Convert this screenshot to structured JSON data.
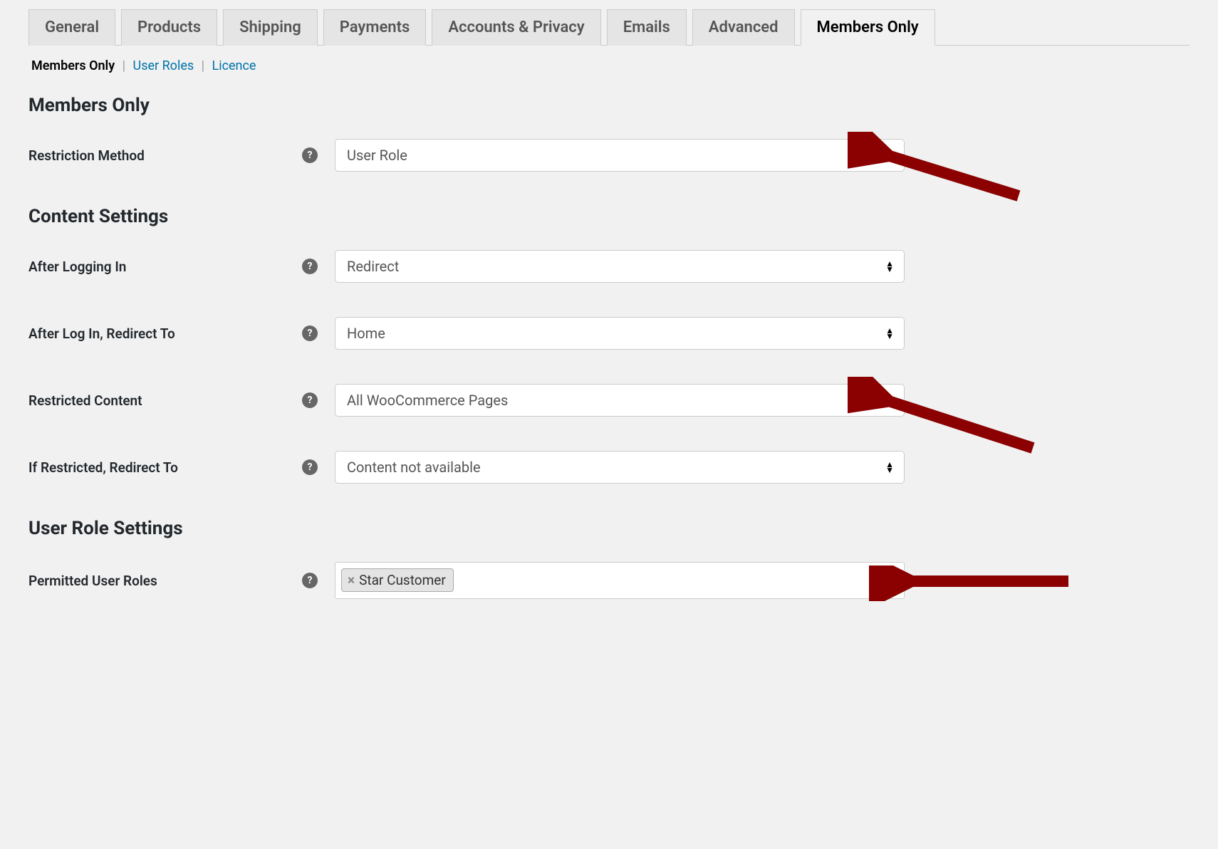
{
  "tabs": [
    {
      "label": "General"
    },
    {
      "label": "Products"
    },
    {
      "label": "Shipping"
    },
    {
      "label": "Payments"
    },
    {
      "label": "Accounts & Privacy"
    },
    {
      "label": "Emails"
    },
    {
      "label": "Advanced"
    },
    {
      "label": "Members Only",
      "active": true
    }
  ],
  "subnav": {
    "items": [
      {
        "label": "Members Only",
        "current": true
      },
      {
        "label": "User Roles"
      },
      {
        "label": "Licence"
      }
    ]
  },
  "sections": {
    "members_only": {
      "title": "Members Only",
      "restriction_method": {
        "label": "Restriction Method",
        "value": "User Role"
      }
    },
    "content_settings": {
      "title": "Content Settings",
      "after_logging_in": {
        "label": "After Logging In",
        "value": "Redirect"
      },
      "after_login_redirect": {
        "label": "After Log In, Redirect To",
        "value": "Home"
      },
      "restricted_content": {
        "label": "Restricted Content",
        "value": "All WooCommerce Pages"
      },
      "if_restricted_redirect": {
        "label": "If Restricted, Redirect To",
        "value": "Content not available"
      }
    },
    "user_role_settings": {
      "title": "User Role Settings",
      "permitted_user_roles": {
        "label": "Permitted User Roles",
        "tags": [
          "Star Customer"
        ]
      }
    }
  },
  "help_tooltip": "?"
}
